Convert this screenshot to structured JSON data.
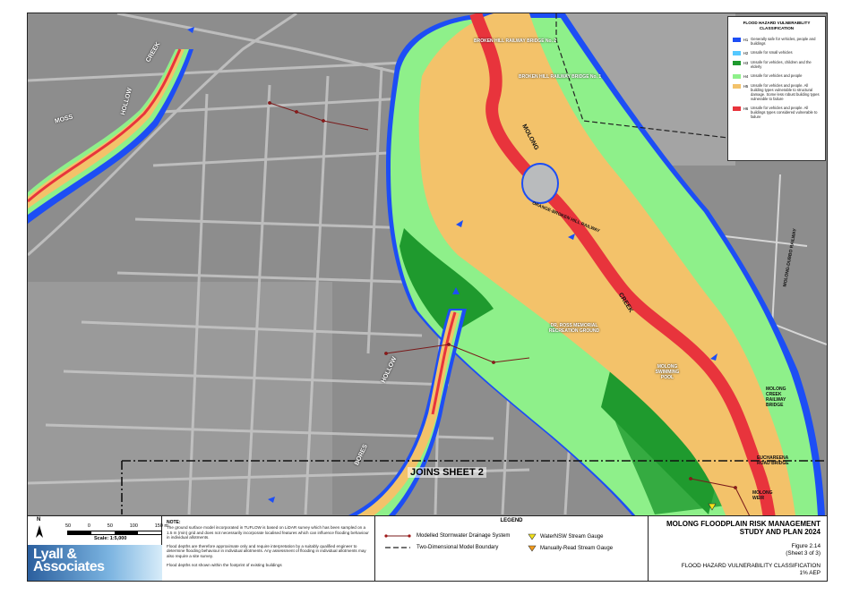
{
  "colors": {
    "H1": "#1d4ef5",
    "H2": "#55c8ff",
    "H3": "#1f9a2e",
    "H4": "#8ef08a",
    "H5": "#f3c26a",
    "H6": "#e8343c"
  },
  "legend_hazard": {
    "title": "FLOOD HAZARD VULNERABILITY CLASSIFICATION",
    "items": [
      {
        "code": "H1",
        "desc": "Generally safe for vehicles, people and buildings"
      },
      {
        "code": "H2",
        "desc": "Unsafe for small vehicles"
      },
      {
        "code": "H3",
        "desc": "Unsafe for vehicles, children and the elderly"
      },
      {
        "code": "H4",
        "desc": "Unsafe for vehicles and people"
      },
      {
        "code": "H5",
        "desc": "Unsafe for vehicles and people. All building types vulnerable to structural damage. Some less robust building types vulnerable to failure"
      },
      {
        "code": "H6",
        "desc": "Unsafe for vehicles and people. All buildings types considered vulnerable to failure"
      }
    ]
  },
  "map_labels": {
    "broken_hill_2": "BROKEN HILL RAILWAY BRIDGE No. 2",
    "broken_hill_1": "BROKEN HILL RAILWAY BRIDGE No. 1",
    "molong": "MOLONG",
    "creek": "CREEK",
    "moss": "MOSS",
    "hollow": "HOLLOW",
    "creek_nw": "CREEK",
    "hollow2": "HOLLOW",
    "bores": "BORES",
    "dr_ross": "DR. ROSS MEMORIAL RECREATION GROUND",
    "pool": "MOLONG SWIMMING POOL",
    "molong_creek_bridge": "MOLONG CREEK RAILWAY BRIDGE",
    "euchareena": "EUCHAREENA ROAD BRIDGE",
    "weir": "MOLONG WEIR",
    "joins": "JOINS SHEET 2",
    "orange_railway": "ORANGE-BROKEN HILL RAILWAY",
    "dubbo_railway": "MOLONG-DUBBO RAILWAY"
  },
  "scale": {
    "ticks": [
      "50",
      "0",
      "50",
      "100",
      "150 m"
    ],
    "text": "Scale: 1:5,000",
    "north": "N"
  },
  "logo": {
    "line1": "Lyall &",
    "line2": "Associates"
  },
  "note": {
    "heading": "NOTE:",
    "p1": "The ground surface model incorporated in TUFLOW is based on LiDAR survey which has been sampled on a 1.5 m (min) grid and does not necessarily incorporate localised features which can influence flooding behaviour in individual allotments.",
    "p2": "Flood depths are therefore approximate only and require interpretation by a suitably qualified engineer to determine flooding behaviour in individual allotments. Any assessment of flooding in individual allotments may also require a site survey.",
    "p3": "Flood depths not shown within the footprint of existing buildings"
  },
  "legend2": {
    "title": "LEGEND",
    "stormwater": "Modelled Stormwater Drainage System",
    "boundary": "Two-Dimensional Model Boundary",
    "gauge": "WaterNSW Stream Gauge",
    "manual": "Manually-Read Stream Gauge"
  },
  "titleblock": {
    "title1": "MOLONG FLOODPLAIN RISK MANAGEMENT",
    "title2": "STUDY AND PLAN 2024",
    "fig": "Figure 2.14",
    "sheet": "(Sheet 3 of 3)",
    "class": "FLOOD HAZARD VULNERABILITY CLASSIFICATION",
    "aep": "1% AEP"
  }
}
